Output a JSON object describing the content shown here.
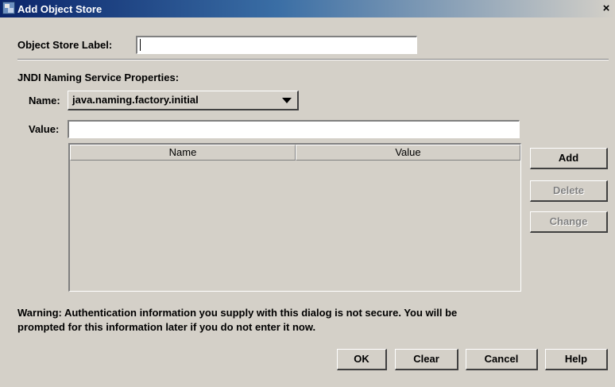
{
  "window": {
    "title": "Add Object Store",
    "close_glyph": "×",
    "icon": "object-store-window-icon"
  },
  "object_store": {
    "label": "Object Store Label:",
    "value": ""
  },
  "jndi": {
    "section_title": "JNDI Naming Service Properties:",
    "name_label": "Name:",
    "name_selected": "java.naming.factory.initial",
    "value_label": "Value:",
    "value": ""
  },
  "table": {
    "columns": [
      "Name",
      "Value"
    ],
    "rows": []
  },
  "side_buttons": {
    "add": "Add",
    "delete": "Delete",
    "change": "Change"
  },
  "warning": {
    "line1": "Warning: Authentication information you supply with this dialog is not secure. You will be",
    "line2": "prompted for this information later if you do not enter it now."
  },
  "footer": {
    "ok": "OK",
    "clear": "Clear",
    "cancel": "Cancel",
    "help": "Help"
  },
  "colors": {
    "title_bar": "#0a246a",
    "dialog_background": "#d4d0c8",
    "disabled_text": "#808080"
  }
}
